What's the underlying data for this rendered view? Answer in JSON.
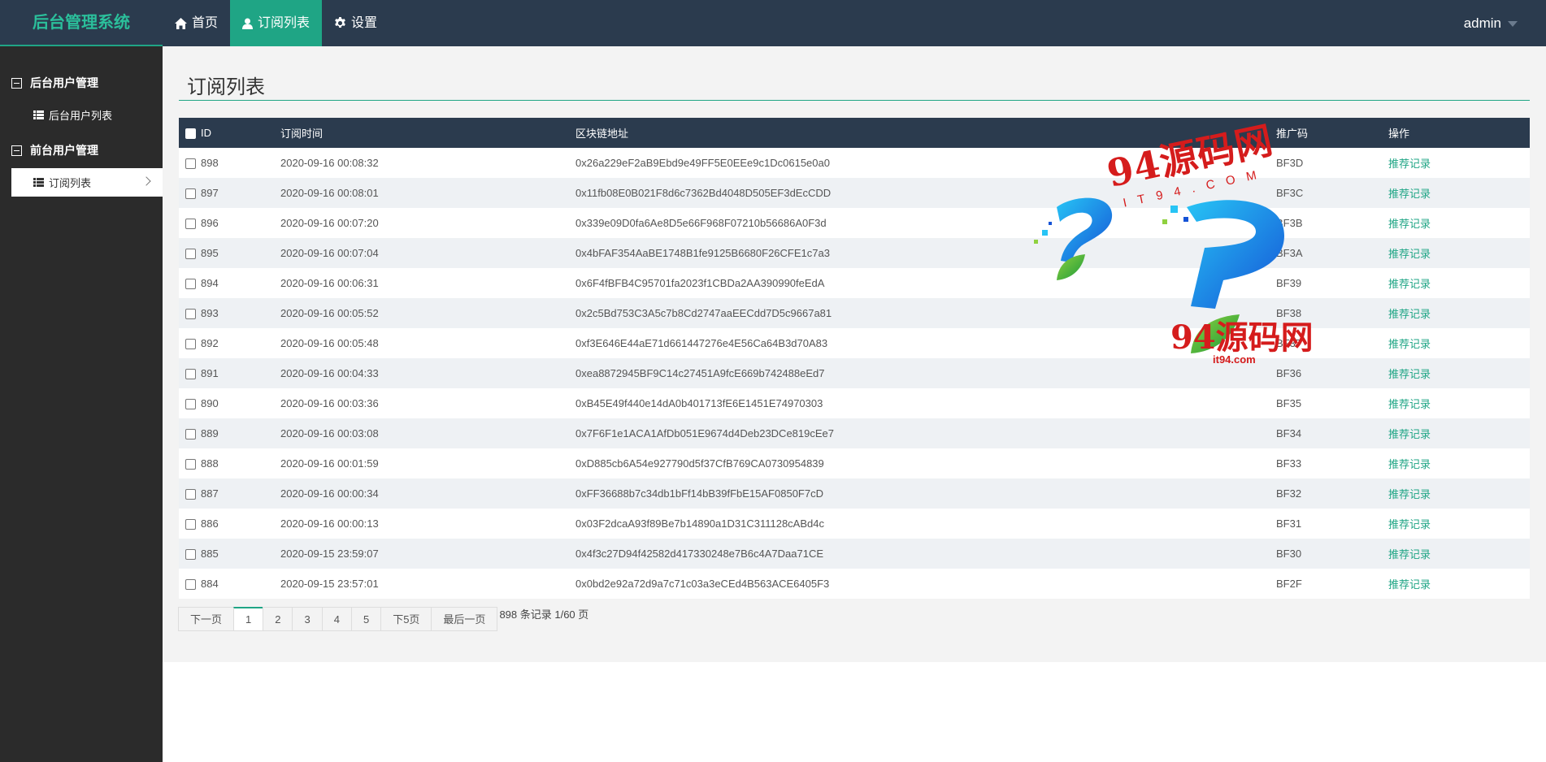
{
  "app": {
    "brand": "后台管理系统",
    "user": "admin"
  },
  "topnav": [
    {
      "label": "首页",
      "icon": "home-icon",
      "active": false
    },
    {
      "label": "订阅列表",
      "icon": "user-icon",
      "active": true
    },
    {
      "label": "设置",
      "icon": "gear-icon",
      "active": false
    }
  ],
  "sidebar": {
    "groups": [
      {
        "label": "后台用户管理",
        "items": [
          {
            "label": "后台用户列表",
            "active": false
          }
        ]
      },
      {
        "label": "前台用户管理",
        "items": [
          {
            "label": "订阅列表",
            "active": true
          }
        ]
      }
    ]
  },
  "page": {
    "title": "订阅列表"
  },
  "table": {
    "columns": [
      "ID",
      "订阅时间",
      "区块链地址",
      "推广码",
      "操作"
    ],
    "action_label": "推荐记录",
    "rows": [
      {
        "id": "898",
        "time": "2020-09-16 00:08:32",
        "address": "0x26a229eF2aB9Ebd9e49FF5E0EEe9c1Dc0615e0a0",
        "code": "BF3D"
      },
      {
        "id": "897",
        "time": "2020-09-16 00:08:01",
        "address": "0x11fb08E0B021F8d6c7362Bd4048D505EF3dEcCDD",
        "code": "BF3C"
      },
      {
        "id": "896",
        "time": "2020-09-16 00:07:20",
        "address": "0x339e09D0fa6Ae8D5e66F968F07210b56686A0F3d",
        "code": "BF3B"
      },
      {
        "id": "895",
        "time": "2020-09-16 00:07:04",
        "address": "0x4bFAF354AaBE1748B1fe9125B6680F26CFE1c7a3",
        "code": "BF3A"
      },
      {
        "id": "894",
        "time": "2020-09-16 00:06:31",
        "address": "0x6F4fBFB4C95701fa2023f1CBDa2AA390990feEdA",
        "code": "BF39"
      },
      {
        "id": "893",
        "time": "2020-09-16 00:05:52",
        "address": "0x2c5Bd753C3A5c7b8Cd2747aaEECdd7D5c9667a81",
        "code": "BF38"
      },
      {
        "id": "892",
        "time": "2020-09-16 00:05:48",
        "address": "0xf3E646E44aE71d661447276e4E56Ca64B3d70A83",
        "code": "BF37"
      },
      {
        "id": "891",
        "time": "2020-09-16 00:04:33",
        "address": "0xea8872945BF9C14c27451A9fcE669b742488eEd7",
        "code": "BF36"
      },
      {
        "id": "890",
        "time": "2020-09-16 00:03:36",
        "address": "0xB45E49f440e14dA0b401713fE6E1451E74970303",
        "code": "BF35"
      },
      {
        "id": "889",
        "time": "2020-09-16 00:03:08",
        "address": "0x7F6F1e1ACA1AfDb051E9674d4Deb23DCe819cEe7",
        "code": "BF34"
      },
      {
        "id": "888",
        "time": "2020-09-16 00:01:59",
        "address": "0xD885cb6A54e927790d5f37CfB769CA0730954839",
        "code": "BF33"
      },
      {
        "id": "887",
        "time": "2020-09-16 00:00:34",
        "address": "0xFF36688b7c34db1bFf14bB39fFbE15AF0850F7cD",
        "code": "BF32"
      },
      {
        "id": "886",
        "time": "2020-09-16 00:00:13",
        "address": "0x03F2dcaA93f89Be7b14890a1D31C311128cABd4c",
        "code": "BF31"
      },
      {
        "id": "885",
        "time": "2020-09-15 23:59:07",
        "address": "0x4f3c27D94f42582d417330248e7B6c4A7Daa71CE",
        "code": "BF30"
      },
      {
        "id": "884",
        "time": "2020-09-15 23:57:01",
        "address": "0x0bd2e92a72d9a7c71c03a3eCEd4B563ACE6405F3",
        "code": "BF2F"
      }
    ]
  },
  "pager": {
    "prev": "下一页",
    "pages": [
      "1",
      "2",
      "3",
      "4",
      "5"
    ],
    "current": "1",
    "next5": "下5页",
    "last": "最后一页",
    "info": "898 条记录 1/60 页"
  },
  "watermark": {
    "line1": "94源码网",
    "line2": "IT94.COM",
    "line3": "94源码网",
    "line4": "it94.com"
  },
  "colors": {
    "accent": "#1fa585",
    "topbar": "#2b3b4e",
    "sidebar": "#2b2b2b"
  }
}
